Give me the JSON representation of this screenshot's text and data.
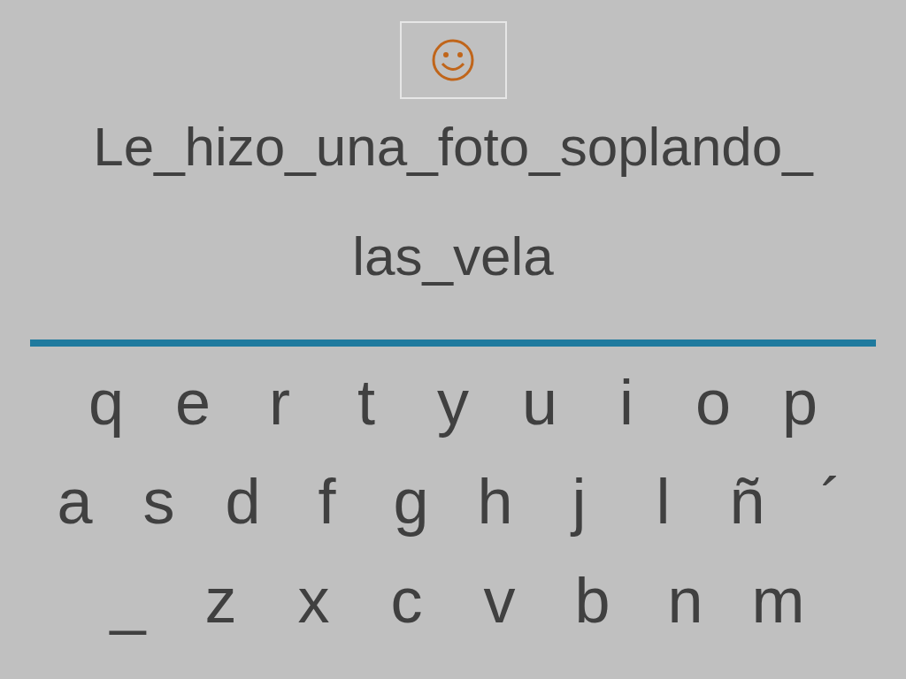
{
  "sentence": {
    "lines": [
      "Le_hizo_una_foto_soplando_",
      "las_vela"
    ]
  },
  "keyboard": {
    "rows": [
      [
        "q",
        "e",
        "r",
        "t",
        "y",
        "u",
        "i",
        "o",
        "p"
      ],
      [
        "a",
        "s",
        "d",
        "f",
        "g",
        "h",
        "j",
        "l",
        "ñ",
        "´"
      ],
      [
        "_",
        "z",
        "x",
        "c",
        "v",
        "b",
        "n",
        "m"
      ]
    ]
  }
}
